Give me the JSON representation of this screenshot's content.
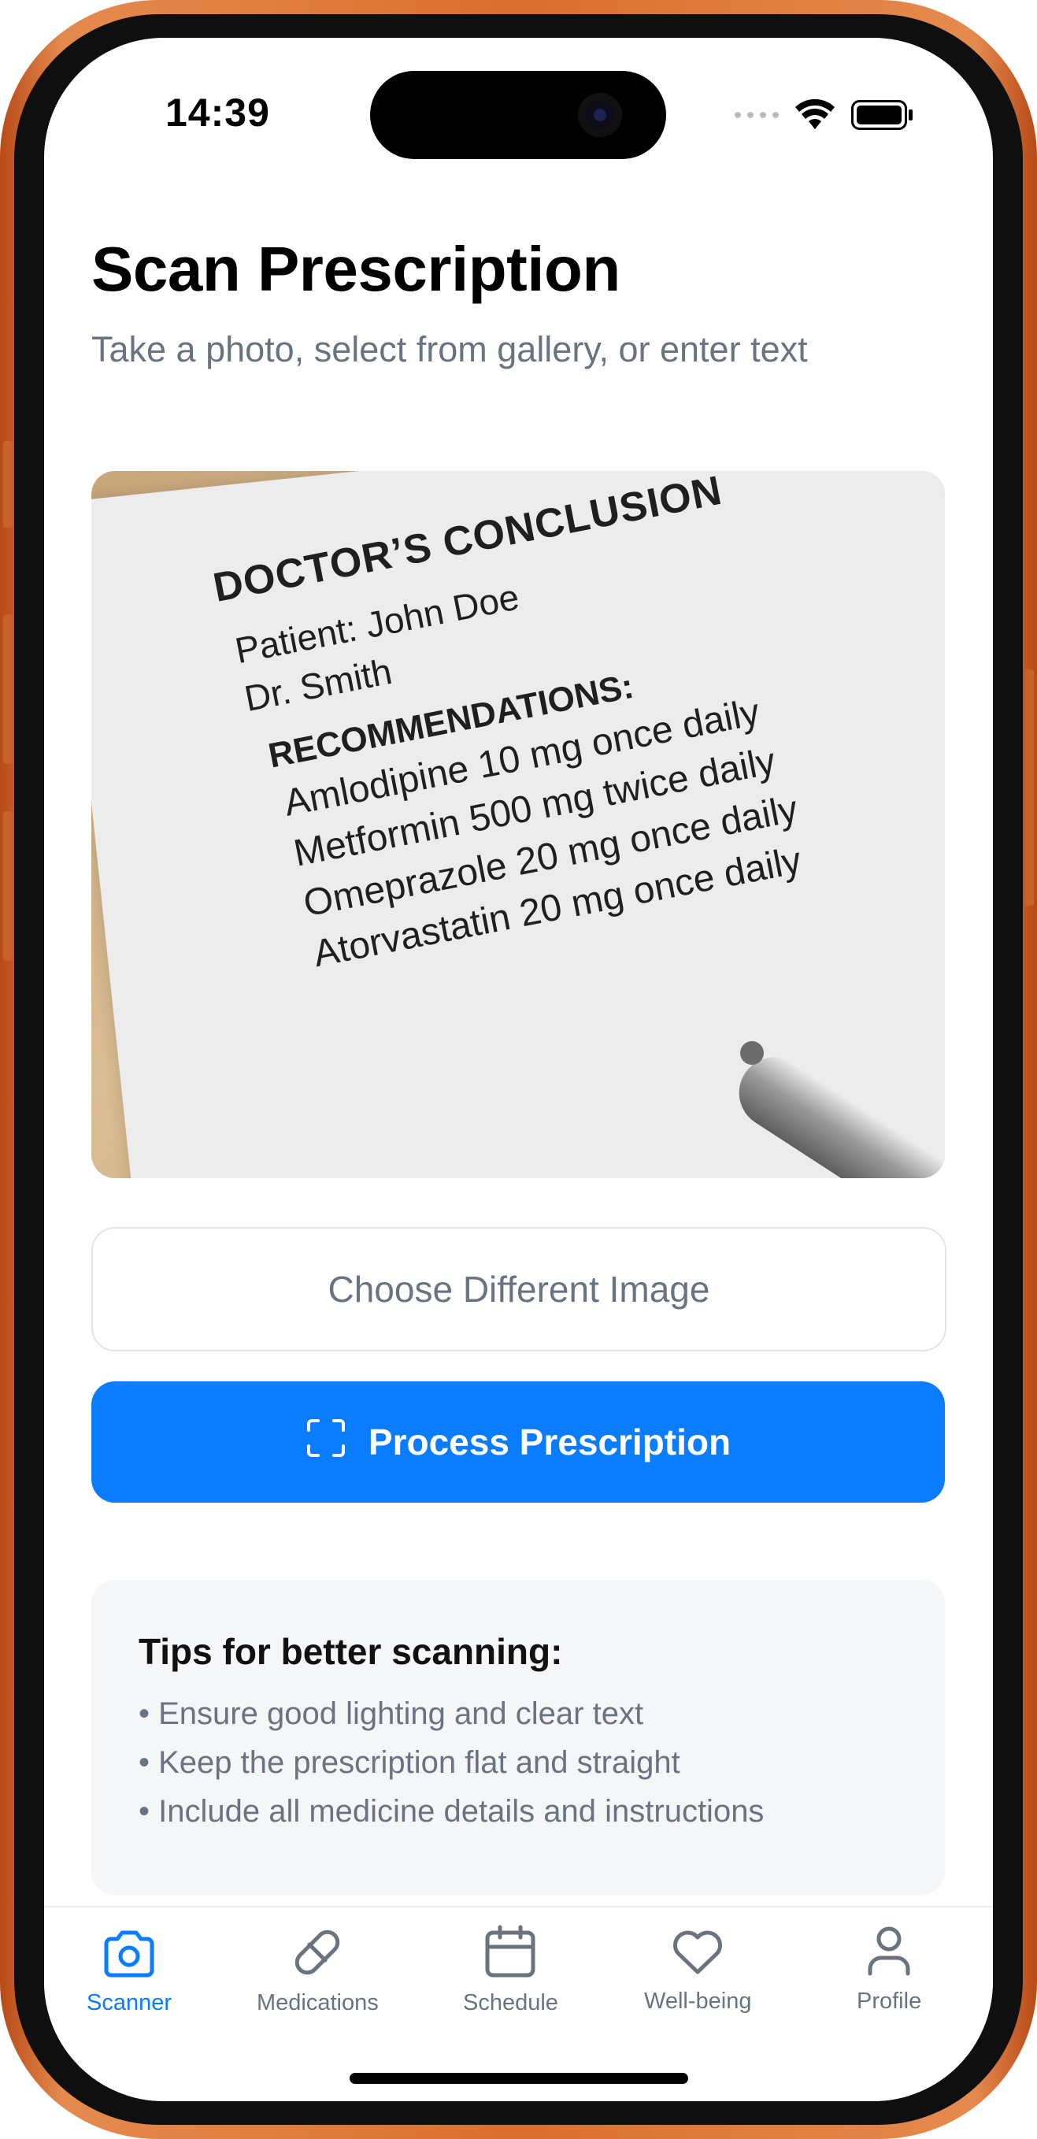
{
  "status": {
    "time": "14:39"
  },
  "page": {
    "title": "Scan Prescription",
    "subtitle": "Take a photo, select from gallery, or enter text"
  },
  "preview": {
    "heading": "DOCTOR’S CONCLUSION",
    "patient": "Patient: John Doe",
    "doctor": "Dr. Smith",
    "recommendations": "RECOMMENDATIONS:",
    "meds": [
      "Amlodipine 10 mg once daily",
      "Metformin 500 mg twice daily",
      "Omeprazole 20 mg once daily",
      "Atorvastatin 20 mg once daily"
    ]
  },
  "actions": {
    "choose_label": "Choose Different Image",
    "process_label": "Process Prescription"
  },
  "tips": {
    "title": "Tips for better scanning:",
    "items": [
      "• Ensure good lighting and clear text",
      "• Keep the prescription flat and straight",
      "• Include all medicine details and instructions"
    ]
  },
  "tabs": [
    {
      "label": "Scanner",
      "icon": "camera-icon",
      "active": true
    },
    {
      "label": "Medications",
      "icon": "pill-icon",
      "active": false
    },
    {
      "label": "Schedule",
      "icon": "calendar-icon",
      "active": false
    },
    {
      "label": "Well-being",
      "icon": "heart-icon",
      "active": false
    },
    {
      "label": "Profile",
      "icon": "user-icon",
      "active": false
    }
  ],
  "colors": {
    "accent": "#0a7cff",
    "frame": "#d96f2d",
    "muted_text": "#6b7280",
    "tips_bg": "#f5f6f8"
  }
}
